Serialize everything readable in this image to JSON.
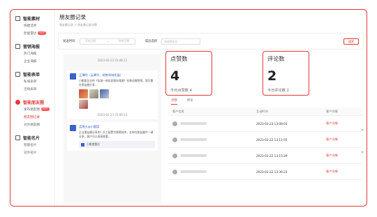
{
  "sidebar": {
    "sections": [
      {
        "title": "智能素材",
        "items": [
          {
            "label": "快捷话术",
            "hot": ""
          },
          {
            "label": "智能雷达",
            "hot": "HOT"
          }
        ]
      },
      {
        "title": "营销海报",
        "items": [
          {
            "label": "热门海报",
            "hot": ""
          },
          {
            "label": "企业海报",
            "hot": ""
          }
        ]
      },
      {
        "title": "智能表单",
        "items": [
          {
            "label": "私域表单",
            "hot": ""
          },
          {
            "label": "活动表单",
            "hot": ""
          }
        ]
      },
      {
        "title": "智能朋友圈",
        "items": [
          {
            "label": "发布朋友圈",
            "hot": "HOT"
          },
          {
            "label": "朋友圈记录",
            "hot": ""
          },
          {
            "label": "对外朋友圈",
            "hot": ""
          }
        ]
      },
      {
        "title": "智能名片",
        "items": [
          {
            "label": "智能名片",
            "hot": ""
          },
          {
            "label": "对外名片",
            "hot": ""
          }
        ]
      }
    ]
  },
  "header": {
    "title": "朋友圈记录",
    "breadcrumb": "朋友圈记录 > 朋友圈记录详情"
  },
  "filter": {
    "time_label": "发送时间",
    "start_placeholder": "开始日期",
    "separator": "→",
    "end_placeholder": "结束日期",
    "member_label": "成员选择",
    "member_placeholder": "请选择成员",
    "search_label": "搜索"
  },
  "feed": [
    {
      "time": "2023-02-23 15:48:11",
      "name": "王薄明（云霄华、销售领域发展）",
      "text": "小额度企业的《私域一体化获客存储源》在移动微营销，我打算在朋友圈分享...",
      "images": 4,
      "footer_time": "2023-02-23 15:06:22"
    },
    {
      "name": "孟晓天@小额度",
      "text": "企业朋友圈分享的？员工配置专属素材库，支持在朋友圈中一键分享，客户可以直接查看...",
      "link_label": "小额度雷达"
    }
  ],
  "stats": {
    "likes_label": "点赞数",
    "likes_value": "4",
    "likes_today": "今日点赞数 4",
    "comments_label": "评论数",
    "comments_value": "2",
    "comments_today": "今日评论数 2"
  },
  "tabs": [
    "点赞",
    "评论"
  ],
  "table": {
    "headers": [
      "客户信息",
      "互动时间",
      "客户详情"
    ],
    "rows": [
      {
        "time": "2023-02-23 13:08:03",
        "action": "客户详情"
      },
      {
        "time": "2023-02-22 13:11:55",
        "action": "客户详情"
      },
      {
        "time": "2023-02-22 13:15:29",
        "action": "客户详情"
      },
      {
        "time": "2023-02-22 13:36:23",
        "action": "客户详情"
      }
    ]
  },
  "colors": {
    "accent": "#e23a3a",
    "link": "#3a62c7"
  }
}
